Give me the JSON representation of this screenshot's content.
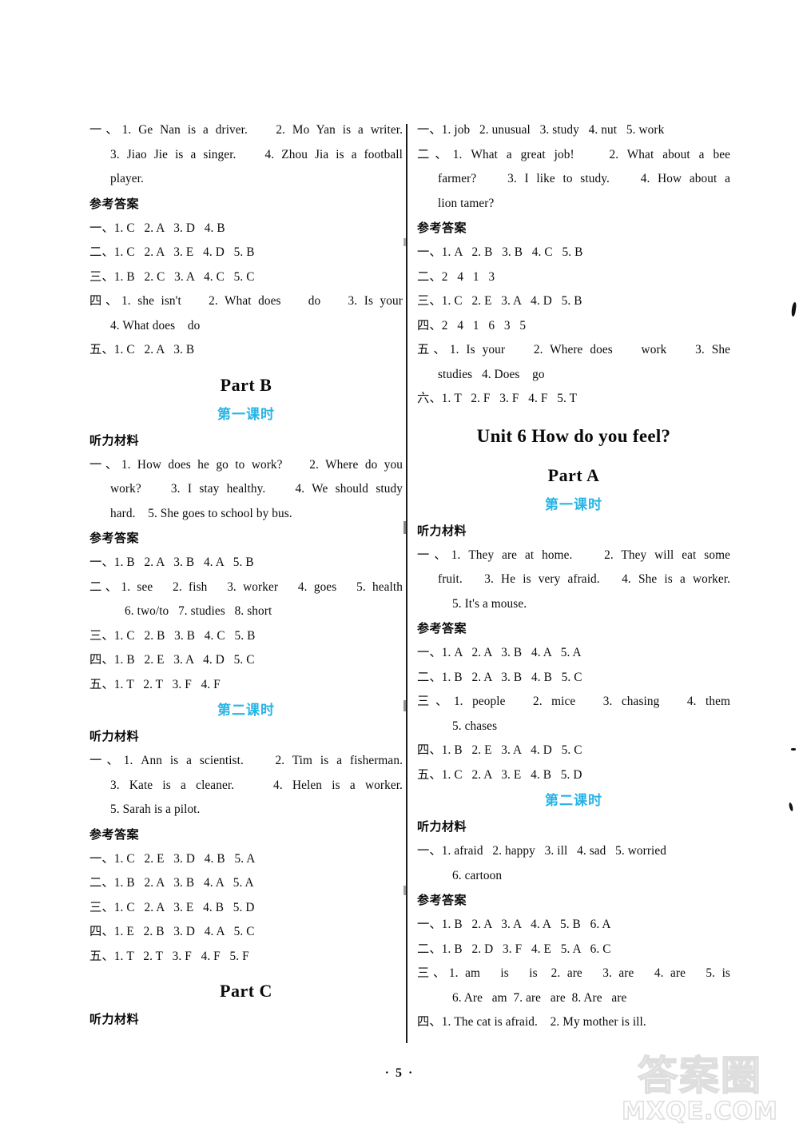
{
  "page": {
    "number": "· 5 ·",
    "watermark_cn": "答案圈",
    "watermark_en": "MXQE.COM"
  },
  "labels": {
    "listening_material": "听力材料",
    "reference_answers": "参考答案",
    "lesson_1": "第一课时",
    "lesson_2": "第二课时",
    "part_b": "Part B",
    "part_c": "Part C",
    "part_a": "Part A",
    "unit6_title": "Unit 6    How do you feel?"
  },
  "left_column": {
    "top_listening": [
      "一、1. Ge Nan is a driver.    2. Mo Yan is a writer.",
      "3. Jiao Jie is a singer.    4. Zhou Jia is a football",
      "player."
    ],
    "top_answers": [
      "一、1. C   2. A   3. D   4. B",
      "二、1. C   2. A   3. E   4. D   5. B",
      "三、1. B   2. C   3. A   4. C   5. C",
      "四、1. she isn't    2. What does    do    3. Is your",
      "4. What does    do",
      "五、1. C   2. A   3. B"
    ],
    "partB_lesson1_listening": [
      "一、1. How does he go to work?    2. Where do you",
      "work?    3. I stay healthy.    4. We should study",
      "hard.    5. She goes to school by bus."
    ],
    "partB_lesson1_answers": [
      "一、1. B   2. A   3. B   4. A   5. B",
      "二、1. see   2. fish   3. worker   4. goes   5. health",
      "6. two/to   7. studies   8. short",
      "三、1. C   2. B   3. B   4. C   5. B",
      "四、1. B   2. E   3. A   4. D   5. C",
      "五、1. T   2. T   3. F   4. F"
    ],
    "partB_lesson2_listening": [
      "一、1. Ann is a scientist.    2. Tim is a fisherman.",
      "3. Kate is a cleaner.    4. Helen is a worker.",
      "5. Sarah is a pilot."
    ],
    "partB_lesson2_answers": [
      "一、1. C   2. E   3. D   4. B   5. A",
      "二、1. B   2. A   3. B   4. A   5. A",
      "三、1. C   2. A   3. E   4. B   5. D",
      "四、1. E   2. B   3. D   4. A   5. C",
      "五、1. T   2. T   3. F   4. F   5. F"
    ]
  },
  "right_column": {
    "top_listening": [
      "一、1. job   2. unusual   3. study   4. nut   5. work",
      "二、1. What a great job!    2. What about a bee",
      "farmer?    3. I like to study.    4. How about a",
      "lion tamer?"
    ],
    "top_answers": [
      "一、1. A   2. B   3. B   4. C   5. B",
      "二、2   4   1   3",
      "三、1. C   2. E   3. A   4. D   5. B",
      "四、2   4   1   6   3   5",
      "五、1. Is your    2. Where does    work    3. She",
      "studies   4. Does    go",
      "六、1. T   2. F   3. F   4. F   5. T"
    ],
    "partA_lesson1_listening": [
      "一、1. They are at home.    2. They will eat some",
      "fruit.   3. He is very afraid.   4. She is a worker.",
      "5. It's a mouse."
    ],
    "partA_lesson1_answers": [
      "一、1. A   2. A   3. B   4. A   5. A",
      "二、1. B   2. A   3. B   4. B   5. C",
      "三、1. people   2. mice   3. chasing   4. them",
      "5. chases",
      "四、1. B   2. E   3. A   4. D   5. C",
      "五、1. C   2. A   3. E   4. B   5. D"
    ],
    "partA_lesson2_listening": [
      "一、1. afraid   2. happy   3. ill   4. sad   5. worried",
      "6. cartoon"
    ],
    "partA_lesson2_answers": [
      "一、1. B   2. A   3. A   4. A   5. B   6. A",
      "二、1. B   2. D   3. F   4. E   5. A   6. C",
      "三、1. am   is   is  2. are   3. are   4. are   5. is",
      "6. Are   am  7. are   are  8. Are   are",
      "四、1. The cat is afraid.    2. My mother is ill."
    ]
  },
  "colors": {
    "lesson_heading": "#26b4e6",
    "text": "#0a0a0a",
    "watermark": "#dedede"
  }
}
